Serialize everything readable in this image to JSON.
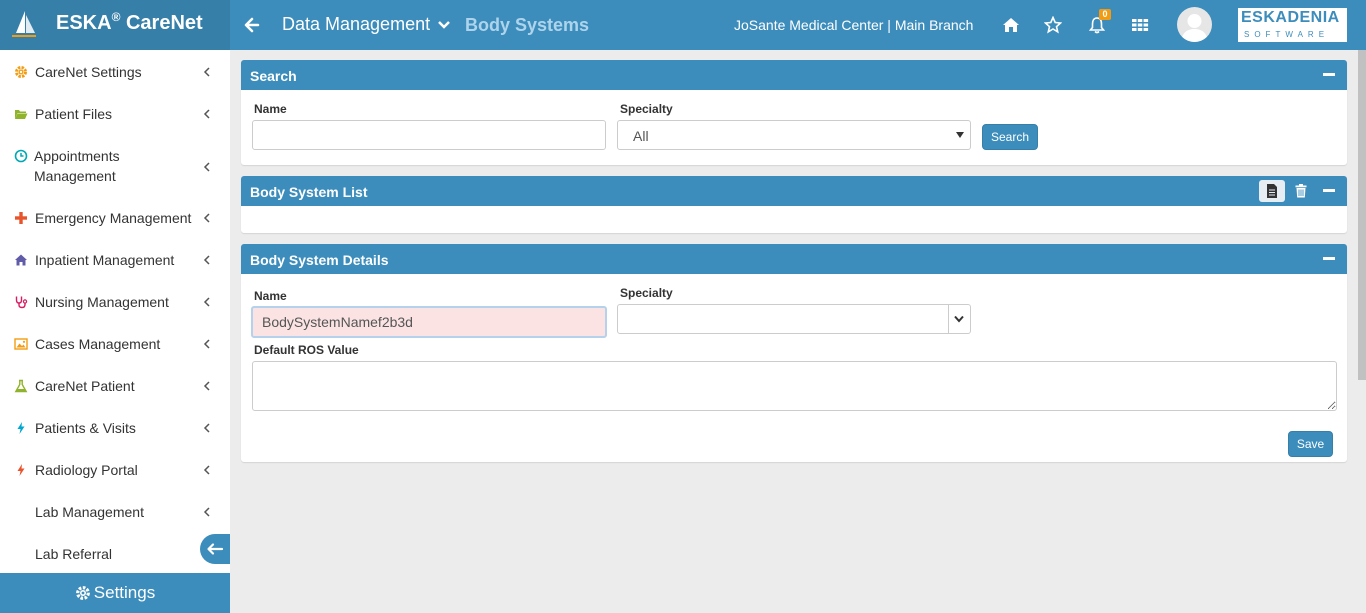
{
  "app": {
    "brand": "ESKA",
    "brand_reg": "®",
    "brand_suffix": "CareNet",
    "company_line1": "ESKADENIA",
    "company_line2": "SOFTWARE"
  },
  "header": {
    "breadcrumb_main": "Data Management",
    "breadcrumb_sub": "Body Systems",
    "facility": "JoSante Medical Center | Main Branch",
    "notification_count": "0"
  },
  "sidebar": {
    "items": [
      {
        "label": "CareNet Settings",
        "icon": "gear-icon",
        "color": "#f39c12"
      },
      {
        "label": "Patient Files",
        "icon": "folder-open-icon",
        "color": "#8fb32a"
      },
      {
        "label": "Appointments Management",
        "icon": "clock-icon",
        "color": "#00a7b5"
      },
      {
        "label": "Emergency Management",
        "icon": "plus-icon",
        "color": "#e8542c"
      },
      {
        "label": "Inpatient Management",
        "icon": "home-icon",
        "color": "#605ca8"
      },
      {
        "label": "Nursing Management",
        "icon": "stethoscope-icon",
        "color": "#d81b60"
      },
      {
        "label": "Cases Management",
        "icon": "image-icon",
        "color": "#f39c12"
      },
      {
        "label": "CareNet Patient",
        "icon": "flask-icon",
        "color": "#8fb32a"
      },
      {
        "label": "Patients & Visits",
        "icon": "bolt-icon",
        "color": "#00a7d0"
      },
      {
        "label": "Radiology Portal",
        "icon": "bolt-icon",
        "color": "#e8542c"
      },
      {
        "label": "Lab Management",
        "icon": "",
        "color": ""
      },
      {
        "label": "Lab Referral",
        "icon": "",
        "color": ""
      }
    ],
    "settings_label": "Settings"
  },
  "search_panel": {
    "title": "Search",
    "name_label": "Name",
    "name_value": "",
    "specialty_label": "Specialty",
    "specialty_selected": "All",
    "search_button": "Search"
  },
  "list_panel": {
    "title": "Body System List"
  },
  "details_panel": {
    "title": "Body System Details",
    "name_label": "Name",
    "name_value": "BodySystemNamef2b3d",
    "specialty_label": "Specialty",
    "specialty_selected": "",
    "ros_label": "Default ROS Value",
    "ros_value": "",
    "save_button": "Save"
  },
  "colors": {
    "primary": "#3c8dbc",
    "primary_dark": "#367fa9",
    "invalid_field": "#fbe3e3"
  }
}
